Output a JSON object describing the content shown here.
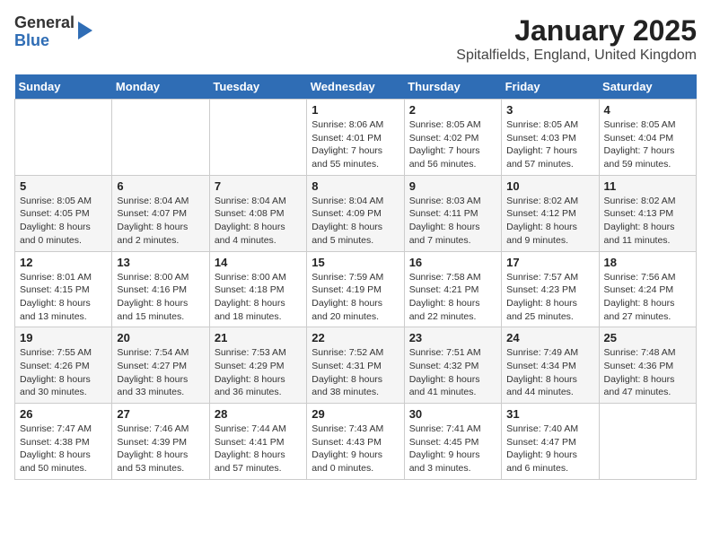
{
  "logo": {
    "general": "General",
    "blue": "Blue"
  },
  "title": "January 2025",
  "subtitle": "Spitalfields, England, United Kingdom",
  "days_header": [
    "Sunday",
    "Monday",
    "Tuesday",
    "Wednesday",
    "Thursday",
    "Friday",
    "Saturday"
  ],
  "weeks": [
    [
      {
        "day": "",
        "sunrise": "",
        "sunset": "",
        "daylight": ""
      },
      {
        "day": "",
        "sunrise": "",
        "sunset": "",
        "daylight": ""
      },
      {
        "day": "",
        "sunrise": "",
        "sunset": "",
        "daylight": ""
      },
      {
        "day": "1",
        "sunrise": "Sunrise: 8:06 AM",
        "sunset": "Sunset: 4:01 PM",
        "daylight": "Daylight: 7 hours and 55 minutes."
      },
      {
        "day": "2",
        "sunrise": "Sunrise: 8:05 AM",
        "sunset": "Sunset: 4:02 PM",
        "daylight": "Daylight: 7 hours and 56 minutes."
      },
      {
        "day": "3",
        "sunrise": "Sunrise: 8:05 AM",
        "sunset": "Sunset: 4:03 PM",
        "daylight": "Daylight: 7 hours and 57 minutes."
      },
      {
        "day": "4",
        "sunrise": "Sunrise: 8:05 AM",
        "sunset": "Sunset: 4:04 PM",
        "daylight": "Daylight: 7 hours and 59 minutes."
      }
    ],
    [
      {
        "day": "5",
        "sunrise": "Sunrise: 8:05 AM",
        "sunset": "Sunset: 4:05 PM",
        "daylight": "Daylight: 8 hours and 0 minutes."
      },
      {
        "day": "6",
        "sunrise": "Sunrise: 8:04 AM",
        "sunset": "Sunset: 4:07 PM",
        "daylight": "Daylight: 8 hours and 2 minutes."
      },
      {
        "day": "7",
        "sunrise": "Sunrise: 8:04 AM",
        "sunset": "Sunset: 4:08 PM",
        "daylight": "Daylight: 8 hours and 4 minutes."
      },
      {
        "day": "8",
        "sunrise": "Sunrise: 8:04 AM",
        "sunset": "Sunset: 4:09 PM",
        "daylight": "Daylight: 8 hours and 5 minutes."
      },
      {
        "day": "9",
        "sunrise": "Sunrise: 8:03 AM",
        "sunset": "Sunset: 4:11 PM",
        "daylight": "Daylight: 8 hours and 7 minutes."
      },
      {
        "day": "10",
        "sunrise": "Sunrise: 8:02 AM",
        "sunset": "Sunset: 4:12 PM",
        "daylight": "Daylight: 8 hours and 9 minutes."
      },
      {
        "day": "11",
        "sunrise": "Sunrise: 8:02 AM",
        "sunset": "Sunset: 4:13 PM",
        "daylight": "Daylight: 8 hours and 11 minutes."
      }
    ],
    [
      {
        "day": "12",
        "sunrise": "Sunrise: 8:01 AM",
        "sunset": "Sunset: 4:15 PM",
        "daylight": "Daylight: 8 hours and 13 minutes."
      },
      {
        "day": "13",
        "sunrise": "Sunrise: 8:00 AM",
        "sunset": "Sunset: 4:16 PM",
        "daylight": "Daylight: 8 hours and 15 minutes."
      },
      {
        "day": "14",
        "sunrise": "Sunrise: 8:00 AM",
        "sunset": "Sunset: 4:18 PM",
        "daylight": "Daylight: 8 hours and 18 minutes."
      },
      {
        "day": "15",
        "sunrise": "Sunrise: 7:59 AM",
        "sunset": "Sunset: 4:19 PM",
        "daylight": "Daylight: 8 hours and 20 minutes."
      },
      {
        "day": "16",
        "sunrise": "Sunrise: 7:58 AM",
        "sunset": "Sunset: 4:21 PM",
        "daylight": "Daylight: 8 hours and 22 minutes."
      },
      {
        "day": "17",
        "sunrise": "Sunrise: 7:57 AM",
        "sunset": "Sunset: 4:23 PM",
        "daylight": "Daylight: 8 hours and 25 minutes."
      },
      {
        "day": "18",
        "sunrise": "Sunrise: 7:56 AM",
        "sunset": "Sunset: 4:24 PM",
        "daylight": "Daylight: 8 hours and 27 minutes."
      }
    ],
    [
      {
        "day": "19",
        "sunrise": "Sunrise: 7:55 AM",
        "sunset": "Sunset: 4:26 PM",
        "daylight": "Daylight: 8 hours and 30 minutes."
      },
      {
        "day": "20",
        "sunrise": "Sunrise: 7:54 AM",
        "sunset": "Sunset: 4:27 PM",
        "daylight": "Daylight: 8 hours and 33 minutes."
      },
      {
        "day": "21",
        "sunrise": "Sunrise: 7:53 AM",
        "sunset": "Sunset: 4:29 PM",
        "daylight": "Daylight: 8 hours and 36 minutes."
      },
      {
        "day": "22",
        "sunrise": "Sunrise: 7:52 AM",
        "sunset": "Sunset: 4:31 PM",
        "daylight": "Daylight: 8 hours and 38 minutes."
      },
      {
        "day": "23",
        "sunrise": "Sunrise: 7:51 AM",
        "sunset": "Sunset: 4:32 PM",
        "daylight": "Daylight: 8 hours and 41 minutes."
      },
      {
        "day": "24",
        "sunrise": "Sunrise: 7:49 AM",
        "sunset": "Sunset: 4:34 PM",
        "daylight": "Daylight: 8 hours and 44 minutes."
      },
      {
        "day": "25",
        "sunrise": "Sunrise: 7:48 AM",
        "sunset": "Sunset: 4:36 PM",
        "daylight": "Daylight: 8 hours and 47 minutes."
      }
    ],
    [
      {
        "day": "26",
        "sunrise": "Sunrise: 7:47 AM",
        "sunset": "Sunset: 4:38 PM",
        "daylight": "Daylight: 8 hours and 50 minutes."
      },
      {
        "day": "27",
        "sunrise": "Sunrise: 7:46 AM",
        "sunset": "Sunset: 4:39 PM",
        "daylight": "Daylight: 8 hours and 53 minutes."
      },
      {
        "day": "28",
        "sunrise": "Sunrise: 7:44 AM",
        "sunset": "Sunset: 4:41 PM",
        "daylight": "Daylight: 8 hours and 57 minutes."
      },
      {
        "day": "29",
        "sunrise": "Sunrise: 7:43 AM",
        "sunset": "Sunset: 4:43 PM",
        "daylight": "Daylight: 9 hours and 0 minutes."
      },
      {
        "day": "30",
        "sunrise": "Sunrise: 7:41 AM",
        "sunset": "Sunset: 4:45 PM",
        "daylight": "Daylight: 9 hours and 3 minutes."
      },
      {
        "day": "31",
        "sunrise": "Sunrise: 7:40 AM",
        "sunset": "Sunset: 4:47 PM",
        "daylight": "Daylight: 9 hours and 6 minutes."
      },
      {
        "day": "",
        "sunrise": "",
        "sunset": "",
        "daylight": ""
      }
    ]
  ]
}
